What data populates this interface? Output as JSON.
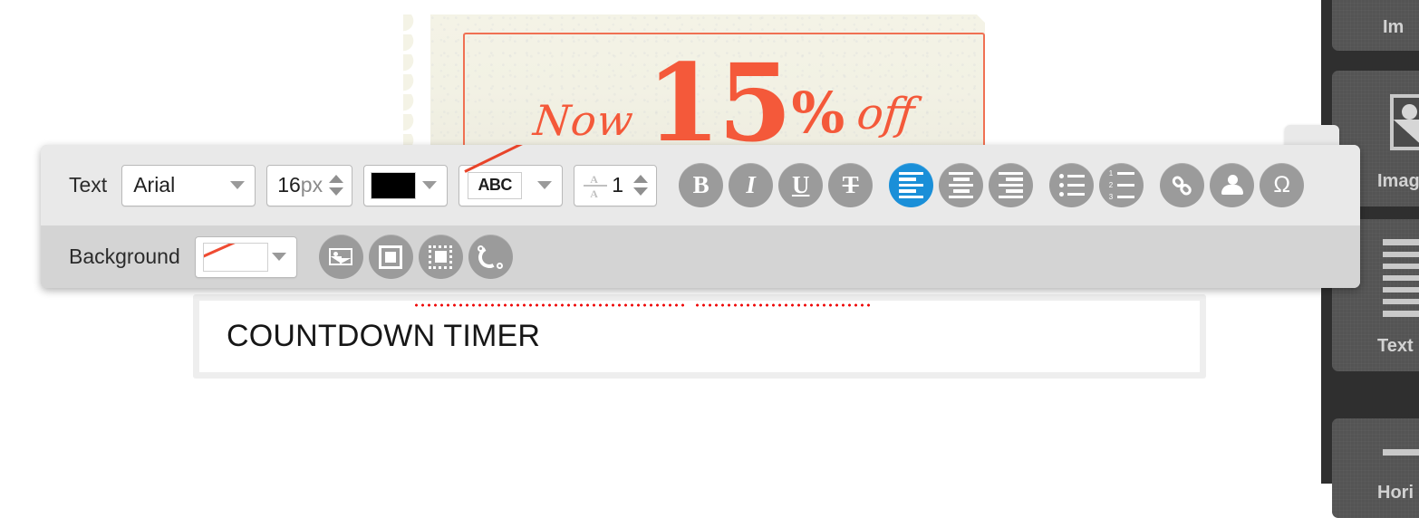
{
  "canvas": {
    "coupon": {
      "now": "Now",
      "number": "15",
      "percent": "%",
      "off": "off",
      "accent_color": "#f4593a",
      "paper_color": "#f2f1e4"
    },
    "text_widget": {
      "content": "COUNTDOWN TIMER",
      "spellcheck_underline_color": "#ee0000"
    }
  },
  "toolbar": {
    "text_row": {
      "label": "Text",
      "font_family": {
        "value": "Arial",
        "icon": "chevron-down-icon"
      },
      "font_size": {
        "value": "16",
        "unit": "px"
      },
      "font_color": {
        "value": "#000000"
      },
      "spellcheck": {
        "value": "ABC",
        "state": "disabled"
      },
      "line_height": {
        "value": "1"
      },
      "buttons": [
        {
          "name": "bold",
          "glyph": "B",
          "active": false
        },
        {
          "name": "italic",
          "glyph": "I",
          "active": false
        },
        {
          "name": "underline",
          "glyph": "U",
          "active": false
        },
        {
          "name": "strikethrough",
          "glyph": "T",
          "active": false
        },
        {
          "name": "align-left",
          "glyph": "bars",
          "active": true
        },
        {
          "name": "align-center",
          "glyph": "bars",
          "active": false
        },
        {
          "name": "align-right",
          "glyph": "bars",
          "active": false
        },
        {
          "name": "bullet-list",
          "glyph": "list",
          "active": false
        },
        {
          "name": "numbered-list",
          "glyph": "list",
          "active": false
        },
        {
          "name": "insert-link",
          "glyph": "link",
          "active": false
        },
        {
          "name": "anchor",
          "glyph": "person",
          "active": false
        },
        {
          "name": "special-character",
          "glyph": "Ω",
          "active": false
        }
      ]
    },
    "background_row": {
      "label": "Background",
      "background_color": {
        "value": "transparent"
      },
      "buttons": [
        {
          "name": "background-image",
          "glyph": "image"
        },
        {
          "name": "border",
          "glyph": "frame"
        },
        {
          "name": "padding",
          "glyph": "padding"
        },
        {
          "name": "corner-radius",
          "glyph": "curve"
        }
      ]
    },
    "accent_color": "#1a8fd8",
    "button_color": "#9b9b9b"
  },
  "sidebar": {
    "background_color": "#2f2f2f",
    "cards": [
      {
        "label": "Im",
        "icon": "image-icon"
      },
      {
        "label": "Image",
        "icon": "image-icon"
      },
      {
        "label": "Text &",
        "icon": "text-lines-icon"
      },
      {
        "label": "Hori",
        "icon": "horizontal-line-icon"
      }
    ]
  }
}
